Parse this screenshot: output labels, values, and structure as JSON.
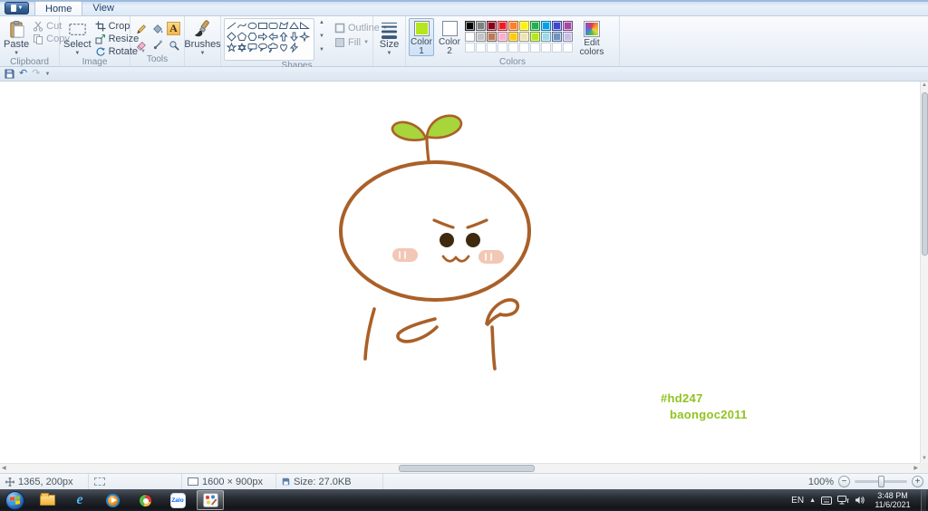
{
  "app": {
    "tabs": [
      {
        "label": "Home",
        "active": true
      },
      {
        "label": "View",
        "active": false
      }
    ]
  },
  "ribbon": {
    "clipboard": {
      "group_label": "Clipboard",
      "paste": "Paste",
      "cut": "Cut",
      "copy": "Copy"
    },
    "image": {
      "group_label": "Image",
      "select": "Select",
      "crop": "Crop",
      "resize": "Resize",
      "rotate": "Rotate"
    },
    "tools": {
      "group_label": "Tools"
    },
    "brushes": {
      "label": "Brushes"
    },
    "shapes": {
      "group_label": "Shapes",
      "outline": "Outline",
      "fill": "Fill"
    },
    "size": {
      "label": "Size"
    },
    "colors": {
      "group_label": "Colors",
      "color1_label": "Color 1",
      "color2_label": "Color 2",
      "edit_colors_label": "Edit colors",
      "color1": "#b5e61d",
      "color2": "#ffffff",
      "palette_rows": [
        [
          "#000000",
          "#7f7f7f",
          "#880015",
          "#ed1c24",
          "#ff7f27",
          "#fff200",
          "#22b14c",
          "#00a2e8",
          "#3f48cc",
          "#a349a4"
        ],
        [
          "#ffffff",
          "#c3c3c3",
          "#b97a57",
          "#ffaec9",
          "#ffc90e",
          "#efe4b0",
          "#b5e61d",
          "#99d9ea",
          "#7092be",
          "#c8bfe7"
        ]
      ],
      "palette_empty_slots": 10
    }
  },
  "canvas": {
    "texts": [
      {
        "value": "#hd247"
      },
      {
        "value": "baongoc2011"
      }
    ],
    "text_color": "#8fc31f",
    "drawing": {
      "outline": "#aa6028",
      "leaf_fill": "#a8d43c",
      "eye_fill": "#3f2a10",
      "blush_fill": "#f3c7b5"
    }
  },
  "status_bar": {
    "cursor_position": "1365, 200px",
    "canvas_size": "1600 × 900px",
    "file_size": "Size: 27.0KB",
    "zoom_level": "100%"
  },
  "taskbar": {
    "zalo_label": "Zalo",
    "tray": {
      "language": "EN",
      "time": "3:48 PM",
      "date": "11/6/2021"
    }
  }
}
